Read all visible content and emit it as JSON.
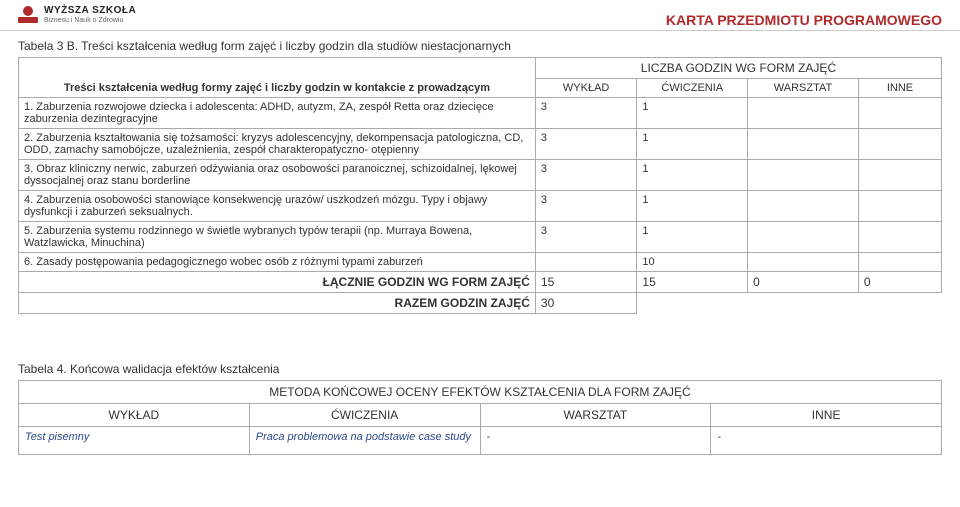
{
  "header": {
    "logo_line1": "WYŻSZA SZKOŁA",
    "logo_line2": "Biznesu i Nauk o Zdrowiu",
    "page_title": "KARTA PRZEDMIOTU PROGRAMOWEGO"
  },
  "table3": {
    "caption": "Tabela 3 B. Treści kształcenia według form zajęć i liczby godzin dla studiów niestacjonarnych",
    "subtitle_left": "Treści kształcenia według formy zajęć i liczby godzin w kontakcie z prowadzącym",
    "group_header": "LICZBA GODZIN WG FORM ZAJĘĆ",
    "cols": {
      "c1": "WYKŁAD",
      "c2": "ĆWICZENIA",
      "c3": "WARSZTAT",
      "c4": "INNE"
    },
    "rows": [
      {
        "n": "1.",
        "text": "Zaburzenia rozwojowe dziecka i adolescenta: ADHD, autyzm, ZA, zespół Retta oraz dziecięce zaburzenia dezintegracyjne",
        "c1": "3",
        "c2": "1",
        "c3": "",
        "c4": ""
      },
      {
        "n": "2.",
        "text": "Zaburzenia kształtowania się tożsamości: kryzys adolescencyjny, dekompensacja patologiczna, CD, ODD, zamachy samobójcze, uzależnienia, zespół charakteropatyczno- otępienny",
        "c1": "3",
        "c2": "1",
        "c3": "",
        "c4": ""
      },
      {
        "n": "3.",
        "text": "Obraz kliniczny nerwic, zaburzeń odżywiania oraz osobowości paranoicznej, schizoidalnej, lękowej dyssocjalnej oraz stanu borderline",
        "c1": "3",
        "c2": "1",
        "c3": "",
        "c4": ""
      },
      {
        "n": "4.",
        "text": "Zaburzenia osobowości stanowiące konsekwencję urazów/ uszkodzeń mózgu. Typy i objawy dysfunkcji i zaburzeń seksualnych.",
        "c1": "3",
        "c2": "1",
        "c3": "",
        "c4": ""
      },
      {
        "n": "5.",
        "text": "Zaburzenia systemu rodzinnego w świetle wybranych typów terapii (np. Murraya Bowena, Watzlawicka, Minuchina)",
        "c1": "3",
        "c2": "1",
        "c3": "",
        "c4": ""
      },
      {
        "n": "6.",
        "text": "Zasady postępowania pedagogicznego wobec osób z różnymi typami zaburzeń",
        "c1": "",
        "c2": "10",
        "c3": "",
        "c4": ""
      }
    ],
    "totals_row": {
      "label": "ŁĄCZNIE GODZIN WG FORM ZAJĘĆ",
      "c1": "15",
      "c2": "15",
      "c3": "0",
      "c4": "0"
    },
    "grand_row": {
      "label": "RAZEM GODZIN ZAJĘĆ",
      "value": "30"
    }
  },
  "table4": {
    "caption": "Tabela 4. Końcowa walidacja efektów kształcenia",
    "banner": "METODA KOŃCOWEJ OCENY EFEKTÓW KSZTAŁCENIA DLA FORM ZAJĘĆ",
    "cols": {
      "c1": "WYKŁAD",
      "c2": "ĆWICZENIA",
      "c3": "WARSZTAT",
      "c4": "INNE"
    },
    "vals": {
      "c1": "Test pisemny",
      "c2": "Praca problemowa na podstawie case study",
      "c3": "-",
      "c4": "-"
    }
  }
}
